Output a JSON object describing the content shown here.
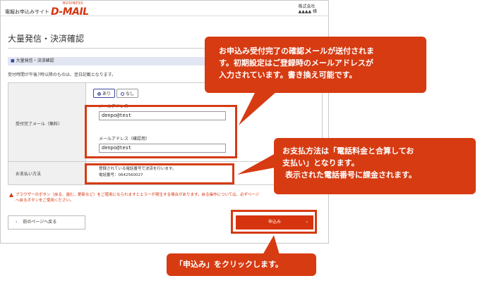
{
  "header": {
    "logo_prefix": "電報お申込みサイト",
    "logo_main": "D-MAIL",
    "logo_business": "BUSINESS",
    "account_company": "株式会社",
    "account_name": "▲▲▲▲ 様"
  },
  "page": {
    "title": "大量発信・決済確認",
    "section_title": "大量発信・決済確認",
    "note": "受付時間が午後7時以降のものは、翌日記載となります。"
  },
  "form": {
    "mail_label": "受付完了メール（無料）",
    "radio_yes": "あり",
    "radio_no": "なし",
    "email_label": "メールアドレス",
    "email_value": "denpo@test",
    "email_confirm_label": "メールアドレス（確認用）",
    "email_confirm_value": "denpo@test",
    "pay_label": "お支払い方法",
    "pay_line1": "登録されている電話番号で決済を行います。",
    "pay_line2": "電話番号：0642560027"
  },
  "warning": {
    "line1": "ブラウザーのボタン（戻る、進む、更新など）をご使用になられますとエラーが発生する場合があります。戻る操作については、必ずページ",
    "line2": "へ戻るボタンをご使用ください。"
  },
  "buttons": {
    "back_label": "前のページへ戻る",
    "submit_label": "申込み"
  },
  "callouts": {
    "email_line1": "お申込み受付完了の確認メールが送付されま",
    "email_line2": "す。初期設定はご登録時のメールアドレスが",
    "email_line3": "入力されています。書き換え可能です。",
    "pay_line1": "お支払方法は「電話料金と合算してお",
    "pay_line2": "支払い」となります。",
    "pay_line3": "表示された電話番号に課金されます。",
    "submit_text": "「申込み」をクリックします。"
  },
  "colors": {
    "accent": "#d63b12",
    "section_bg": "#e2e6f2"
  }
}
